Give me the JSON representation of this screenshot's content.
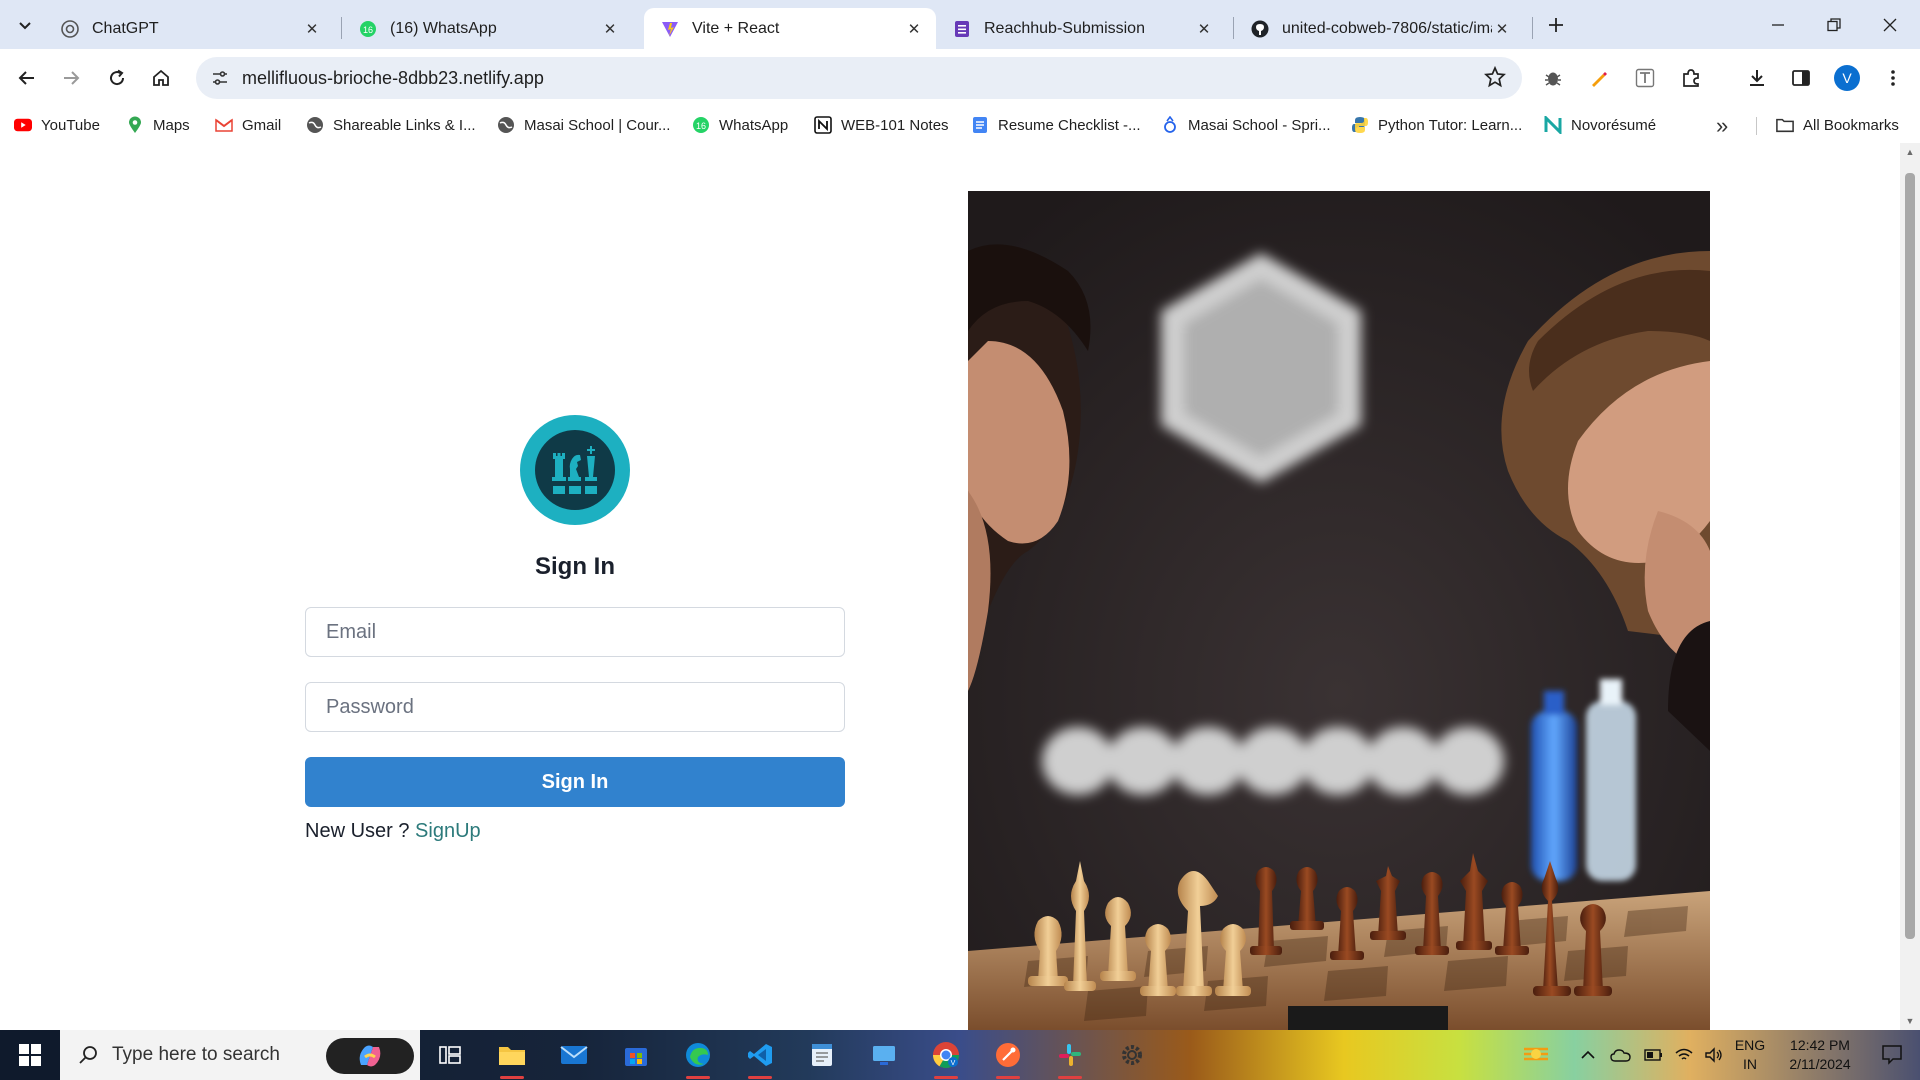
{
  "browser": {
    "tabs": [
      {
        "title": "ChatGPT",
        "favicon": "chatgpt-icon"
      },
      {
        "title": "(16) WhatsApp",
        "favicon": "whatsapp-icon"
      },
      {
        "title": "Vite + React",
        "favicon": "vite-icon"
      },
      {
        "title": "Reachhub-Submission",
        "favicon": "forms-icon"
      },
      {
        "title": "united-cobweb-7806/static/ima",
        "favicon": "github-icon"
      }
    ],
    "url": "mellifluous-brioche-8dbb23.netlify.app",
    "profile_initial": "V",
    "profile_color": "#0b6fd0"
  },
  "bookmarks": {
    "items": [
      {
        "label": "YouTube",
        "icon": "youtube-icon"
      },
      {
        "label": "Maps",
        "icon": "maps-icon"
      },
      {
        "label": "Gmail",
        "icon": "gmail-icon"
      },
      {
        "label": "Shareable Links & I...",
        "icon": "globe-icon"
      },
      {
        "label": "Masai School | Cour...",
        "icon": "globe-icon"
      },
      {
        "label": "WhatsApp",
        "icon": "whatsapp-icon"
      },
      {
        "label": "WEB-101 Notes",
        "icon": "notion-icon"
      },
      {
        "label": "Resume Checklist -...",
        "icon": "docs-icon"
      },
      {
        "label": "Masai School - Spri...",
        "icon": "masai-icon"
      },
      {
        "label": "Python Tutor: Learn...",
        "icon": "python-icon"
      },
      {
        "label": "Novorésumé",
        "icon": "novoresume-icon"
      }
    ],
    "all_bookmarks": "All Bookmarks"
  },
  "signin": {
    "title": "Sign In",
    "email_placeholder": "Email",
    "password_placeholder": "Password",
    "submit_label": "Sign In",
    "new_user_text": "New User ?",
    "signup_link": "SignUp",
    "accent_color": "#3182ce",
    "logo_color": "#1db0c1"
  },
  "taskbar": {
    "search_placeholder": "Type here to search",
    "lang_top": "ENG",
    "lang_bottom": "IN",
    "time": "12:42 PM",
    "date": "2/11/2024"
  }
}
